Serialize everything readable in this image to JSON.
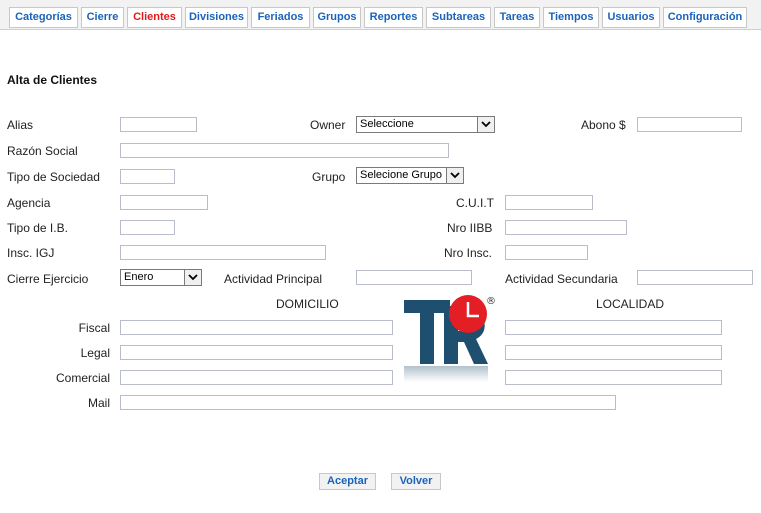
{
  "tabs": [
    {
      "label": "Categorías"
    },
    {
      "label": "Cierre"
    },
    {
      "label": "Clientes"
    },
    {
      "label": "Divisiones"
    },
    {
      "label": "Feriados"
    },
    {
      "label": "Grupos"
    },
    {
      "label": "Reportes"
    },
    {
      "label": "Subtareas"
    },
    {
      "label": "Tareas"
    },
    {
      "label": "Tiempos"
    },
    {
      "label": "Usuarios"
    },
    {
      "label": "Configuración"
    }
  ],
  "active_tab": "Clientes",
  "form": {
    "title": "Alta de Clientes",
    "labels": {
      "alias": "Alias",
      "owner": "Owner",
      "abono": "Abono $",
      "razon_social": "Razón Social",
      "tipo_sociedad": "Tipo de Sociedad",
      "grupo": "Grupo",
      "agencia": "Agencia",
      "cuit": "C.U.I.T",
      "tipo_ib": "Tipo de I.B.",
      "nro_iibb": "Nro IIBB",
      "insc_igj": "Insc. IGJ",
      "nro_insc": "Nro Insc.",
      "cierre_ejercicio": "Cierre Ejercicio",
      "actividad_principal": "Actividad Principal",
      "actividad_secundaria": "Actividad Secundaria",
      "domicilio": "DOMICILIO",
      "localidad": "LOCALIDAD",
      "fiscal": "Fiscal",
      "legal": "Legal",
      "comercial": "Comercial",
      "mail": "Mail"
    },
    "selects": {
      "owner": "Seleccione",
      "grupo": "Selecione Grupo",
      "cierre": "Enero"
    }
  },
  "logo": {
    "text": "TR",
    "registered": "®",
    "color_dark": "#1e4f6e",
    "color_red": "#e31e24"
  },
  "buttons": {
    "aceptar": "Aceptar",
    "volver": "Volver"
  },
  "colors": {
    "tab_text": "#1b63b8",
    "tab_active": "#e11b1b"
  }
}
